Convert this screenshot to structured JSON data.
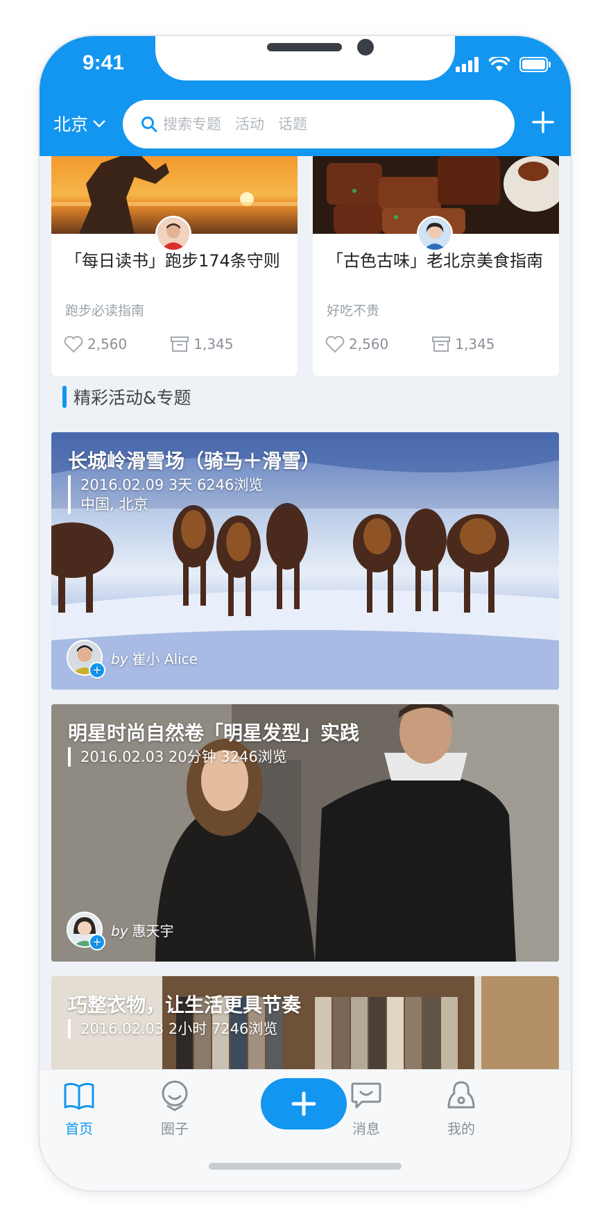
{
  "status_bar": {
    "time": "9:41"
  },
  "header": {
    "city": "北京",
    "search_placeholder": "搜索专题   活动   话题"
  },
  "cards": [
    {
      "title": "「每日读书」跑步174条守则",
      "subtitle": "跑步必读指南",
      "likes": "2,560",
      "favorites": "1,345"
    },
    {
      "title": "「古色古味」老北京美食指南",
      "subtitle": "好吃不贵",
      "likes": "2,560",
      "favorites": "1,345"
    }
  ],
  "section": {
    "title": "精彩活动&专题"
  },
  "banners": [
    {
      "title": "长城岭滑雪场（骑马＋滑雪）",
      "meta": "2016.02.09   3天   6246浏览",
      "location": "中国, 北京",
      "by": "by",
      "author": "崔小 Alice"
    },
    {
      "title": "明星时尚自然卷「明星发型」实践",
      "meta": "2016.02.03   20分钟   3246浏览",
      "by": "by",
      "author": "惠天宇"
    },
    {
      "title": "巧整衣物，让生活更具节奏",
      "meta": "2016.02.03   2小时   7246浏览"
    }
  ],
  "tabbar": {
    "items": [
      {
        "label": "首页",
        "icon": "book-icon",
        "active": true
      },
      {
        "label": "圈子",
        "icon": "face-icon"
      },
      {
        "label": "",
        "icon": "plus-icon"
      },
      {
        "label": "消息",
        "icon": "chat-icon"
      },
      {
        "label": "我的",
        "icon": "user-icon"
      }
    ]
  },
  "colors": {
    "accent": "#1296f0",
    "background": "#eef1f5"
  }
}
